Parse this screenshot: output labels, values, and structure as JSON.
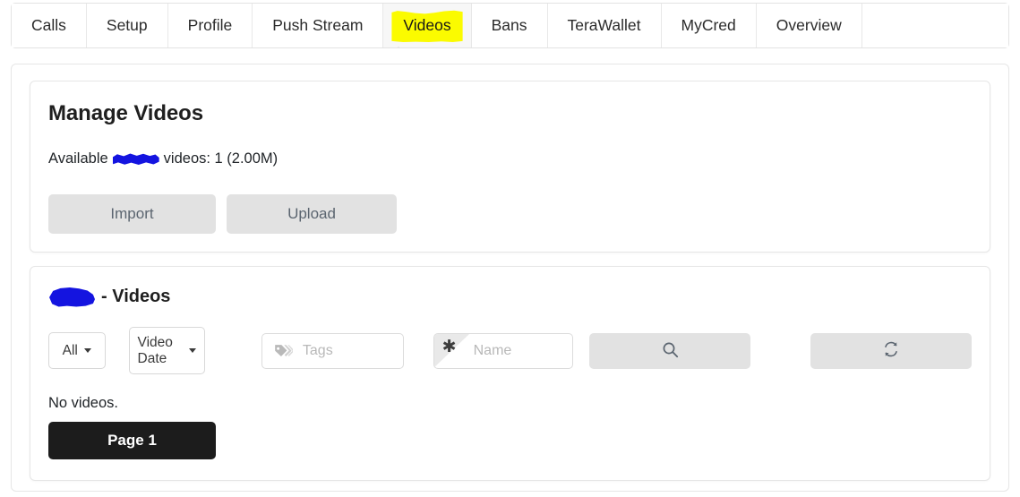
{
  "tabs": [
    {
      "label": "Calls",
      "active": false
    },
    {
      "label": "Setup",
      "active": false
    },
    {
      "label": "Profile",
      "active": false
    },
    {
      "label": "Push Stream",
      "active": false
    },
    {
      "label": "Videos",
      "active": true
    },
    {
      "label": "Bans",
      "active": false
    },
    {
      "label": "TeraWallet",
      "active": false
    },
    {
      "label": "MyCred",
      "active": false
    },
    {
      "label": "Overview",
      "active": false
    }
  ],
  "manage_card": {
    "title": "Manage Videos",
    "available_prefix": "Available",
    "available_suffix": "videos: 1 (2.00M)",
    "import_label": "Import",
    "upload_label": "Upload"
  },
  "list_card": {
    "title_suffix": "- Videos",
    "filter_all_label": "All",
    "sort_label": "Video Date",
    "tags_placeholder": "Tags",
    "name_placeholder": "Name",
    "name_required_glyph": "✱",
    "search_icon": "search-icon",
    "refresh_icon": "refresh-icon",
    "tags_icon": "tag-icon",
    "empty_message": "No videos.",
    "page_label": "Page 1"
  },
  "colors": {
    "highlight": "#fbfb00",
    "redaction": "#1414e0",
    "button_gray": "#e2e2e2",
    "page_button": "#1c1c1c",
    "text": "#212529"
  }
}
